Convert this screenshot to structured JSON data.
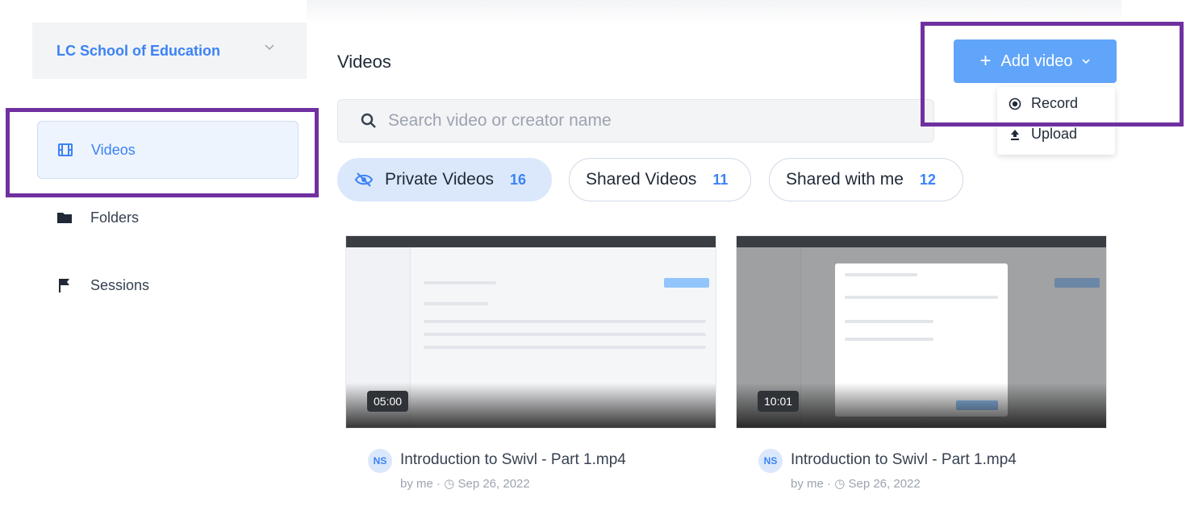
{
  "sidebar": {
    "org_name": "LC School of Education",
    "items": [
      {
        "label": "Videos",
        "icon": "film-icon",
        "active": true
      },
      {
        "label": "Folders",
        "icon": "folder-icon",
        "active": false
      },
      {
        "label": "Sessions",
        "icon": "flag-icon",
        "active": false
      }
    ]
  },
  "main": {
    "title": "Videos",
    "search_placeholder": "Search video or creator name",
    "filters": [
      {
        "label": "Private Videos",
        "count": "16"
      },
      {
        "label": "Shared Videos",
        "count": "11"
      },
      {
        "label": "Shared with me",
        "count": "12"
      }
    ],
    "add_video": {
      "label": "Add video",
      "menu": [
        {
          "label": "Record",
          "icon": "record-icon"
        },
        {
          "label": "Upload",
          "icon": "upload-icon"
        }
      ]
    },
    "videos": [
      {
        "duration": "05:00",
        "avatar": "NS",
        "title": "Introduction to Swivl - Part 1.mp4",
        "author": "by me",
        "date": "Sep 26, 2022"
      },
      {
        "duration": "10:01",
        "avatar": "NS",
        "title": "Introduction to Swivl - Part 1.mp4",
        "author": "by me",
        "date": "Sep 26, 2022"
      }
    ]
  },
  "colors": {
    "accent": "#3b82f6",
    "button": "#60a5fa",
    "highlight_box": "#7030a0",
    "active_bg": "#eef4fd"
  }
}
